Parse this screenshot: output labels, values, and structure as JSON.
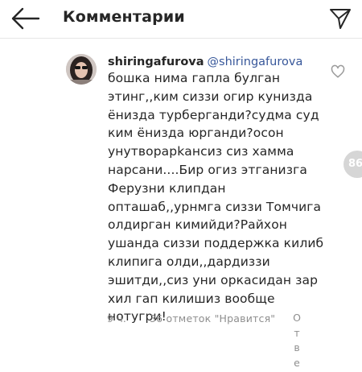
{
  "header": {
    "title": "Комментарии",
    "back_icon": "arrow-left-icon",
    "share_icon": "paper-plane-icon"
  },
  "comment": {
    "username": "shiringafurova",
    "mention": "@shiringafurova",
    "text": "бошка нима гапла булган\nэтинг,,ким сиззи огир кунизда\nёнизда турберганди?судма суд\nким ёнизда юрганди?осон\nунутворарkансиз сиз хамма\nнарсани....Бир огиз этганизга\nФерузни клипдан\nопташаб,,урнмга сиззи Томчига\nолдирган кимийди?Райхон\nушанда сиззи поддержка килиб\nклипига олди,,дардиззи\nэшитди,,сиз уни оркасидан зар\nхил гап килишиз вообще\nнотугри!",
    "time": "9 ч.",
    "likes": "36 отметок \"Нравится\"",
    "reply_letters": [
      "О",
      "т",
      "в",
      "е"
    ],
    "like_icon": "heart-outline-icon",
    "avatar_icon": "user-avatar"
  },
  "side_badge": "86"
}
